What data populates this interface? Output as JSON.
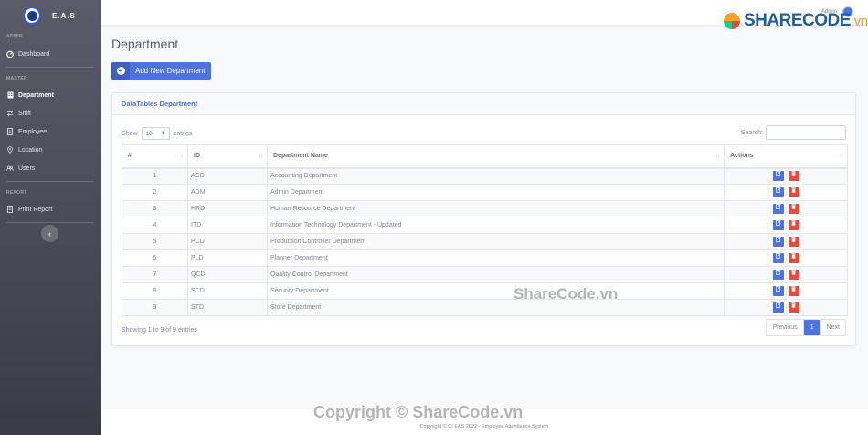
{
  "app": {
    "brand": "E.A.S"
  },
  "sidebar": {
    "heading_admin": "ADMIN",
    "heading_master": "MASTER",
    "heading_report": "REPORT",
    "dashboard": "Dashboard",
    "master_items": [
      {
        "label": "Department",
        "icon": "building-icon",
        "active": true
      },
      {
        "label": "Shift",
        "icon": "exchange-icon",
        "active": false
      },
      {
        "label": "Employee",
        "icon": "id-card-icon",
        "active": false
      },
      {
        "label": "Location",
        "icon": "map-marker-icon",
        "active": false
      },
      {
        "label": "Users",
        "icon": "users-icon",
        "active": false
      }
    ],
    "print_report": "Print Report",
    "toggle": "‹"
  },
  "topbar": {
    "user_name": "Admin"
  },
  "watermark": {
    "logo_text": "SHARECODE",
    "logo_suffix": ".vn",
    "middle": "ShareCode.vn",
    "bottom": "Copyright © ShareCode.vn"
  },
  "page": {
    "title": "Department",
    "add_button": "Add New Department"
  },
  "card": {
    "title": "DataTables Department",
    "show_label": "Show",
    "entries_value": "10",
    "entries_label": "entries",
    "search_label": "Search:",
    "columns": [
      "#",
      "ID",
      "Department Name",
      "Actions"
    ],
    "rows": [
      {
        "no": "1",
        "id": "ACD",
        "name": "Accounting Department"
      },
      {
        "no": "2",
        "id": "ADM",
        "name": "Admin Department"
      },
      {
        "no": "3",
        "id": "HRD",
        "name": "Human Resource Department"
      },
      {
        "no": "4",
        "id": "ITD",
        "name": "Information Technology Department - Updated"
      },
      {
        "no": "5",
        "id": "PCD",
        "name": "Production Controller Department"
      },
      {
        "no": "6",
        "id": "PLD",
        "name": "Planner Department"
      },
      {
        "no": "7",
        "id": "QCD",
        "name": "Quality Control Department"
      },
      {
        "no": "8",
        "id": "SCD",
        "name": "Security Department"
      },
      {
        "no": "9",
        "id": "STD",
        "name": "Store Department"
      }
    ],
    "info": "Showing 1 to 9 of 9 entries",
    "pagination": {
      "previous": "Previous",
      "current": "1",
      "next": "Next"
    }
  },
  "footer": {
    "text": "Copyright © CI EAS 2022 - Employee Attendance System"
  },
  "colors": {
    "primary": "#4e73df",
    "danger": "#e74a3b",
    "sidebar": "#4a4b55"
  }
}
